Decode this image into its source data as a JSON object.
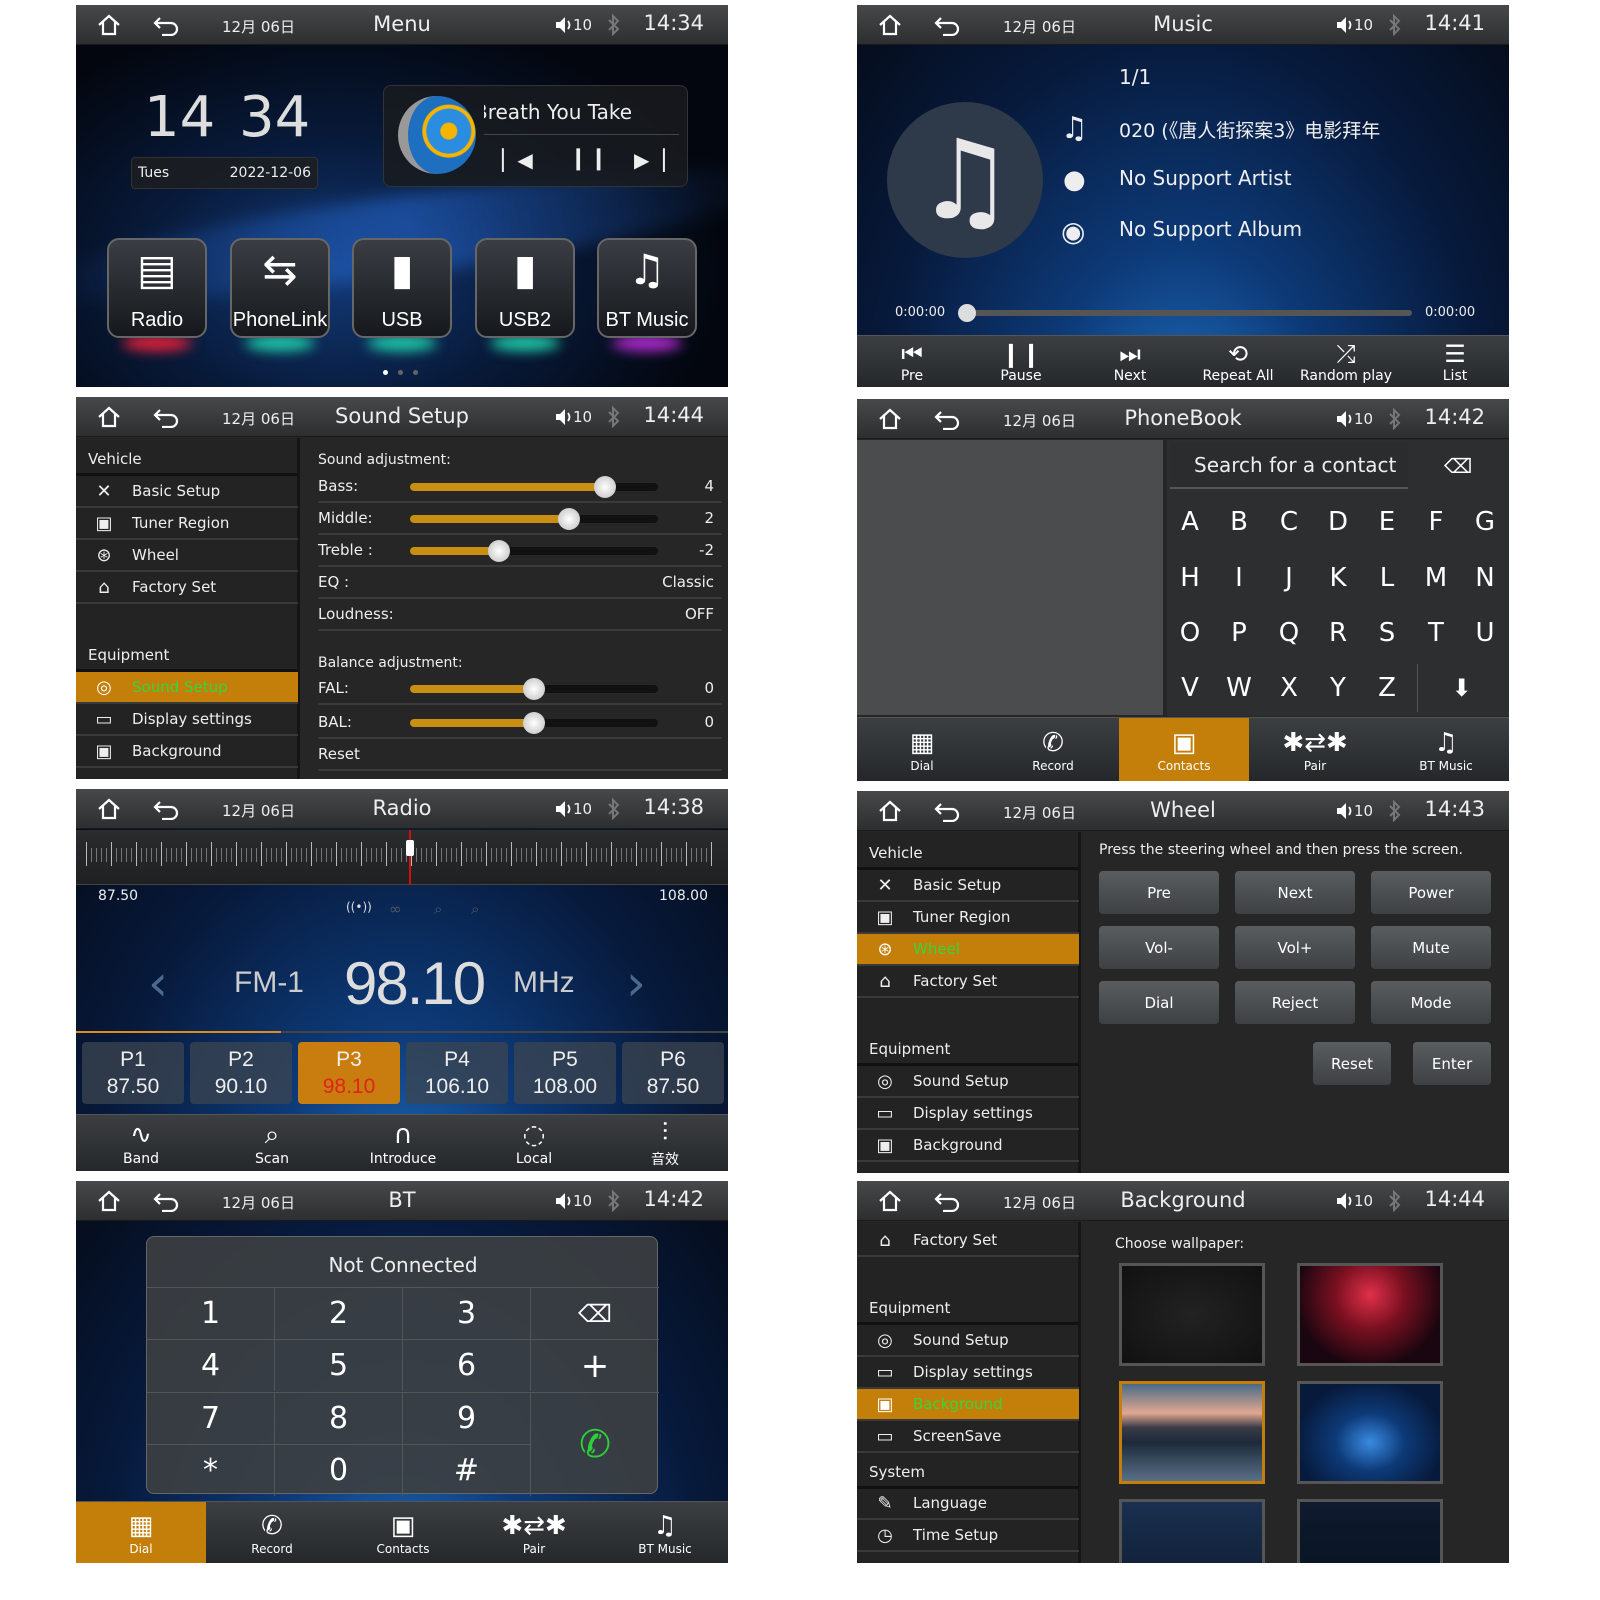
{
  "status_bar": {
    "date": "12月 06日",
    "volume": "10",
    "icons": [
      "home-icon",
      "back-icon",
      "speaker-icon",
      "bluetooth-icon"
    ]
  },
  "panels": {
    "menu": {
      "header": {
        "title": "Menu",
        "time": "14:34"
      },
      "clock": {
        "hours": "14",
        "minutes": "34",
        "weekday": "Tues",
        "date": "2022-12-06"
      },
      "now_playing": {
        "title": "Breath You Take",
        "controls": [
          "previous",
          "pause",
          "next"
        ]
      },
      "apps": [
        {
          "label": "Radio",
          "icon": "radio-icon",
          "glow": "#e0203a"
        },
        {
          "label": "PhoneLink",
          "icon": "phonelink-icon",
          "glow": "#1fc9a8"
        },
        {
          "label": "USB",
          "icon": "usb-icon",
          "glow": "#1fc9a8"
        },
        {
          "label": "USB2",
          "icon": "usb-icon",
          "glow": "#1fc9a8"
        },
        {
          "label": "BT Music",
          "icon": "music-note-icon",
          "glow": "#b02ad0"
        }
      ],
      "page_indicator": {
        "pages": 3,
        "current": 1
      }
    },
    "music": {
      "header": {
        "title": "Music",
        "time": "14:41"
      },
      "track_index": "1/1",
      "track_title": "020 (《唐人街探案3》电影拜年",
      "artist": "No Support Artist",
      "album": "No Support Album",
      "elapsed": "0:00:00",
      "duration": "0:00:00",
      "progress": 0,
      "controls": [
        {
          "label": "Pre",
          "icon": "⏮"
        },
        {
          "label": "Pause",
          "icon": "❙❙"
        },
        {
          "label": "Next",
          "icon": "⏭"
        },
        {
          "label": "Repeat All",
          "icon": "⟲"
        },
        {
          "label": "Random play",
          "icon": "⤮"
        },
        {
          "label": "List",
          "icon": "☰"
        }
      ]
    },
    "sound_setup": {
      "header": {
        "title": "Sound Setup",
        "time": "14:44"
      },
      "sidebar": [
        {
          "type": "section",
          "label": "Vehicle"
        },
        {
          "type": "item",
          "label": "Basic Setup",
          "icon": "✕"
        },
        {
          "type": "item",
          "label": "Tuner Region",
          "icon": "▣"
        },
        {
          "type": "item",
          "label": "Wheel",
          "icon": "⊛"
        },
        {
          "type": "item",
          "label": "Factory Set",
          "icon": "⌂"
        },
        {
          "type": "section",
          "label": "Equipment"
        },
        {
          "type": "item",
          "label": "Sound Setup",
          "icon": "◎",
          "active": true
        },
        {
          "type": "item",
          "label": "Display settings",
          "icon": "▭"
        },
        {
          "type": "item",
          "label": "Background",
          "icon": "▣"
        }
      ],
      "sound_heading": "Sound adjustment:",
      "sliders": [
        {
          "label": "Bass:",
          "value": 4,
          "min": -7,
          "max": 7
        },
        {
          "label": "Middle:",
          "value": 2,
          "min": -7,
          "max": 7
        },
        {
          "label": "Treble :",
          "value": -2,
          "min": -7,
          "max": 7
        }
      ],
      "eq": {
        "label": "EQ :",
        "value": "Classic"
      },
      "loudness": {
        "label": "Loudness:",
        "value": "OFF"
      },
      "balance_heading": "Balance adjustment:",
      "balance": [
        {
          "label": "FAL:",
          "value": 0,
          "min": -7,
          "max": 7
        },
        {
          "label": "BAL:",
          "value": 0,
          "min": -7,
          "max": 7
        }
      ],
      "reset": "Reset"
    },
    "phonebook": {
      "header": {
        "title": "PhoneBook",
        "time": "14:42"
      },
      "search_placeholder": "Search for a contact",
      "keys": [
        [
          "A",
          "B",
          "C",
          "D",
          "E",
          "F",
          "G"
        ],
        [
          "H",
          "I",
          "J",
          "K",
          "L",
          "M",
          "N"
        ],
        [
          "O",
          "P",
          "Q",
          "R",
          "S",
          "T",
          "U"
        ],
        [
          "V",
          "W",
          "X",
          "Y",
          "Z"
        ]
      ],
      "enter_key_icon": "⬇",
      "tabs": [
        {
          "label": "Dial",
          "icon": "▦"
        },
        {
          "label": "Record",
          "icon": "✆"
        },
        {
          "label": "Contacts",
          "icon": "▣",
          "active": true
        },
        {
          "label": "Pair",
          "icon": "✱⇄✱"
        },
        {
          "label": "BT Music",
          "icon": "♫"
        }
      ]
    },
    "radio": {
      "header": {
        "title": "Radio",
        "time": "14:38"
      },
      "range_min": "87.50",
      "range_max": "108.00",
      "band": "FM-1",
      "frequency": "98.10",
      "unit": "MHz",
      "status_icons": [
        "stereo-signal-icon",
        "stereo-icon",
        "search-icon",
        "local-search-icon"
      ],
      "presets": [
        {
          "label": "P1",
          "freq": "87.50"
        },
        {
          "label": "P2",
          "freq": "90.10"
        },
        {
          "label": "P3",
          "freq": "98.10",
          "active": true
        },
        {
          "label": "P4",
          "freq": "106.10"
        },
        {
          "label": "P5",
          "freq": "108.00"
        },
        {
          "label": "P6",
          "freq": "87.50"
        }
      ],
      "controls": [
        {
          "label": "Band",
          "icon": "∿"
        },
        {
          "label": "Scan",
          "icon": "⌕"
        },
        {
          "label": "Introduce",
          "icon": "∩"
        },
        {
          "label": "Local",
          "icon": "◌"
        },
        {
          "label": "音效",
          "icon": "⫶"
        }
      ]
    },
    "wheel": {
      "header": {
        "title": "Wheel",
        "time": "14:43"
      },
      "sidebar": [
        {
          "type": "section",
          "label": "Vehicle"
        },
        {
          "type": "item",
          "label": "Basic Setup",
          "icon": "✕"
        },
        {
          "type": "item",
          "label": "Tuner Region",
          "icon": "▣"
        },
        {
          "type": "item",
          "label": "Wheel",
          "icon": "⊛",
          "active": true
        },
        {
          "type": "item",
          "label": "Factory Set",
          "icon": "⌂"
        },
        {
          "type": "section",
          "label": "Equipment"
        },
        {
          "type": "item",
          "label": "Sound Setup",
          "icon": "◎"
        },
        {
          "type": "item",
          "label": "Display settings",
          "icon": "▭"
        },
        {
          "type": "item",
          "label": "Background",
          "icon": "▣"
        }
      ],
      "instruction": "Press the steering wheel and then press the screen.",
      "buttons": [
        "Pre",
        "Next",
        "Power",
        "Vol-",
        "Vol+",
        "Mute",
        "Dial",
        "Reject",
        "Mode"
      ],
      "reset": "Reset",
      "enter": "Enter"
    },
    "bt": {
      "header": {
        "title": "BT",
        "time": "14:42"
      },
      "status": "Not Connected",
      "keypad": [
        "1",
        "2",
        "3",
        "4",
        "5",
        "6",
        "7",
        "8",
        "9",
        "*",
        "0",
        "#"
      ],
      "tabs": [
        {
          "label": "Dial",
          "icon": "▦",
          "active": true
        },
        {
          "label": "Record",
          "icon": "✆"
        },
        {
          "label": "Contacts",
          "icon": "▣"
        },
        {
          "label": "Pair",
          "icon": "✱⇄✱"
        },
        {
          "label": "BT Music",
          "icon": "♫"
        }
      ]
    },
    "background": {
      "header": {
        "title": "Background",
        "time": "14:44"
      },
      "sidebar": [
        {
          "type": "item",
          "label": "Factory Set",
          "icon": "⌂"
        },
        {
          "type": "section",
          "label": "Equipment"
        },
        {
          "type": "item",
          "label": "Sound Setup",
          "icon": "◎"
        },
        {
          "type": "item",
          "label": "Display settings",
          "icon": "▭"
        },
        {
          "type": "item",
          "label": "Background",
          "icon": "▣",
          "active": true
        },
        {
          "type": "item",
          "label": "ScreenSave",
          "icon": "▭"
        },
        {
          "type": "section",
          "label": "System"
        },
        {
          "type": "item",
          "label": "Language",
          "icon": "✎"
        },
        {
          "type": "item",
          "label": "Time Setup",
          "icon": "◷"
        }
      ],
      "heading": "Choose wallpaper:",
      "wallpapers": [
        {
          "name": "dark-texture"
        },
        {
          "name": "red-stage"
        },
        {
          "name": "lake-sunset",
          "selected": true
        },
        {
          "name": "blue-light"
        },
        {
          "name": "dark-blue"
        },
        {
          "name": "dark-blue-2"
        }
      ],
      "accent": "#c47f0a"
    }
  }
}
